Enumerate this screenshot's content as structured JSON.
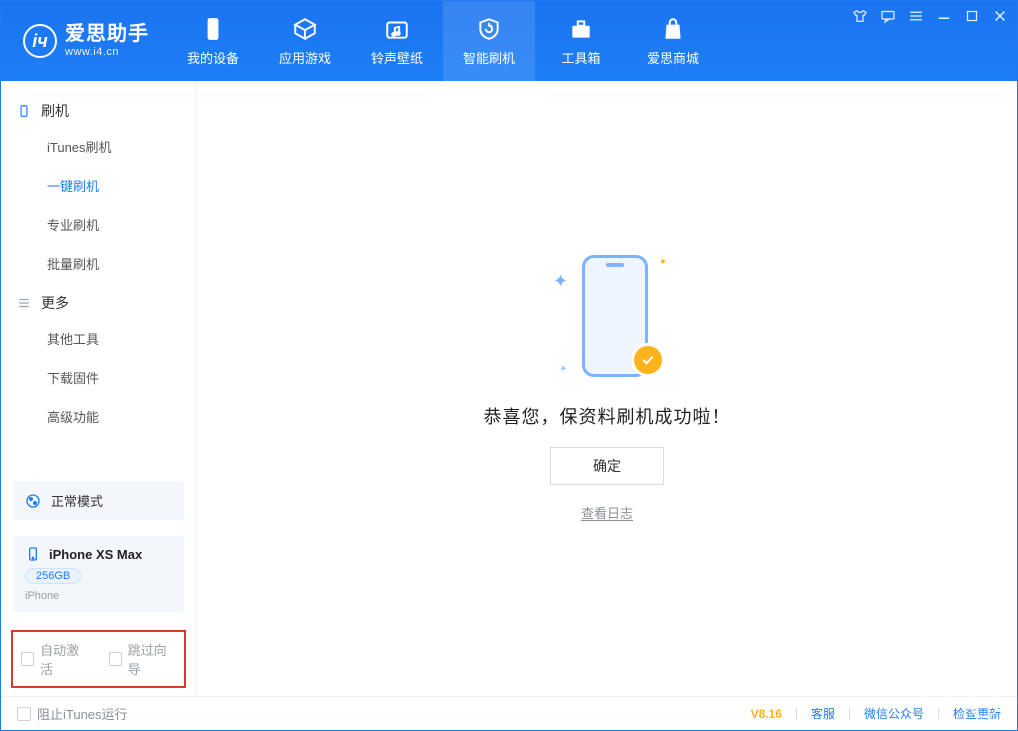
{
  "logo": {
    "title": "爱思助手",
    "subtitle": "www.i4.cn"
  },
  "nav": {
    "device": "我的设备",
    "apps": "应用游戏",
    "ringtones": "铃声壁纸",
    "flash": "智能刷机",
    "toolbox": "工具箱",
    "store": "爱思商城"
  },
  "sidebar": {
    "group_flash": "刷机",
    "items_flash": {
      "itunes": "iTunes刷机",
      "oneclick": "一键刷机",
      "pro": "专业刷机",
      "batch": "批量刷机"
    },
    "group_more": "更多",
    "items_more": {
      "other": "其他工具",
      "download": "下载固件",
      "advanced": "高级功能"
    },
    "mode": "正常模式",
    "device_name": "iPhone XS Max",
    "device_storage": "256GB",
    "device_type": "iPhone",
    "chk_activate": "自动激活",
    "chk_skip": "跳过向导"
  },
  "main": {
    "title": "恭喜您，保资料刷机成功啦！",
    "ok": "确定",
    "viewlog": "查看日志"
  },
  "status": {
    "block_itunes": "阻止iTunes运行",
    "version": "V8.16",
    "support": "客服",
    "wechat": "微信公众号",
    "update": "检查更新"
  }
}
